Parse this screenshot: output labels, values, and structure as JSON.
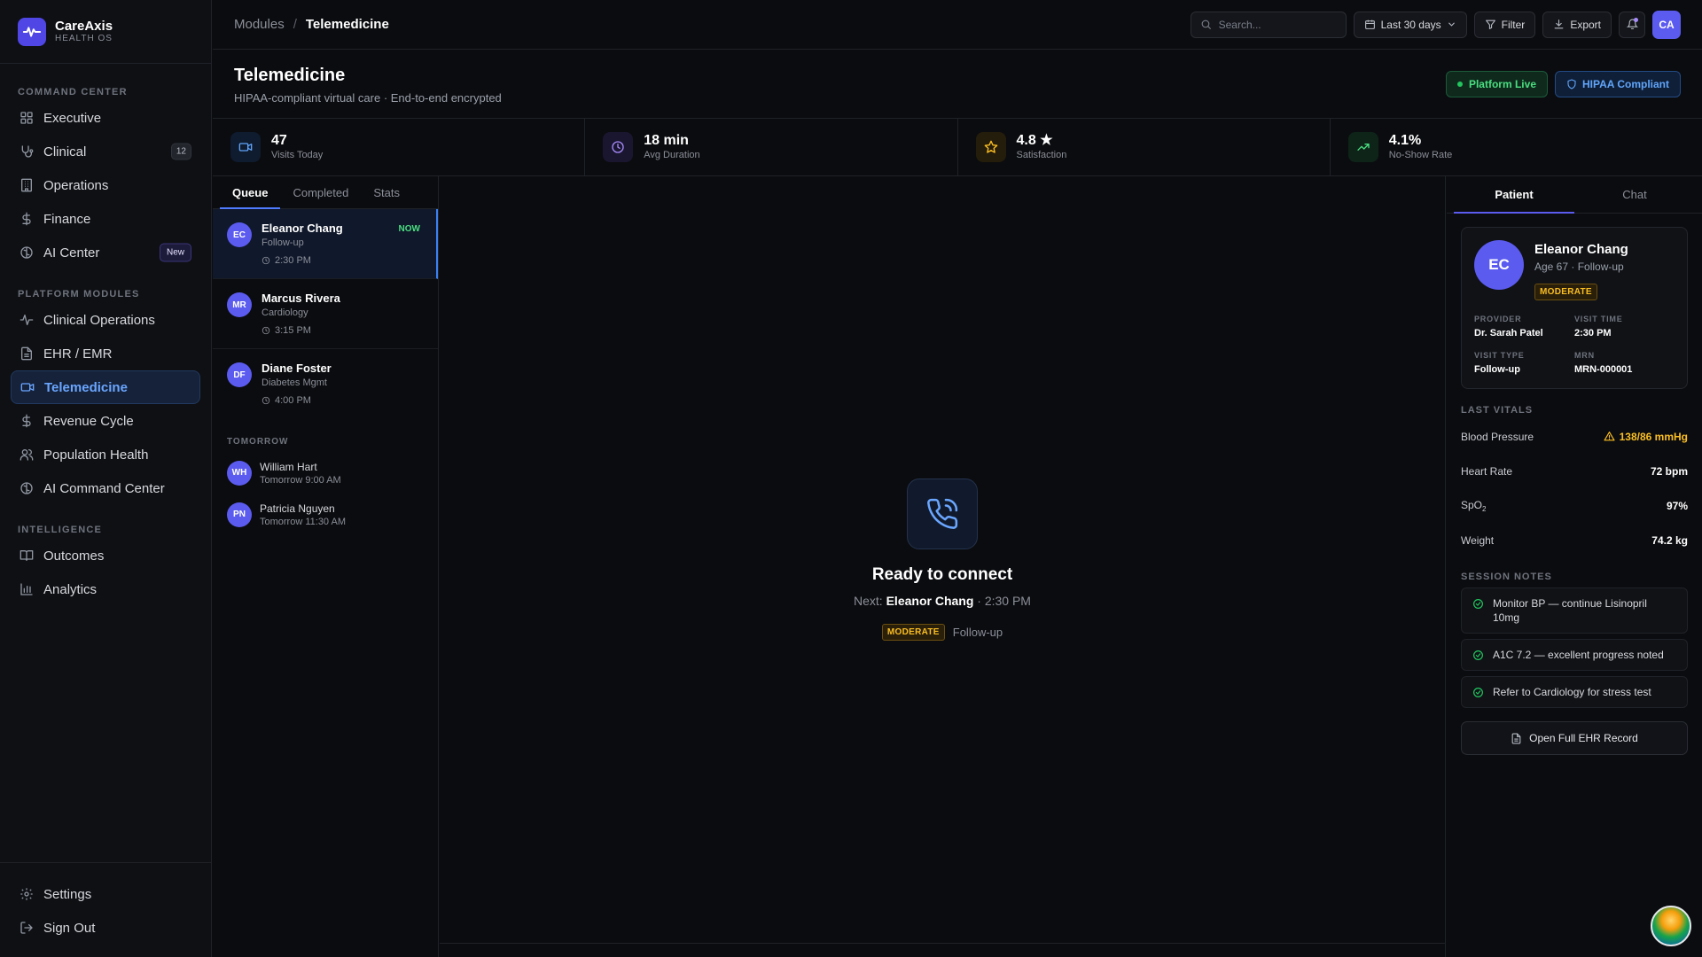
{
  "brand": {
    "name": "CareAxis",
    "sub": "HEALTH OS"
  },
  "sidebar": {
    "sections": [
      {
        "title": "COMMAND CENTER",
        "items": [
          {
            "label": "Executive",
            "icon": "grid-icon"
          },
          {
            "label": "Clinical",
            "icon": "stethoscope-icon",
            "badge": "12"
          },
          {
            "label": "Operations",
            "icon": "building-icon"
          },
          {
            "label": "Finance",
            "icon": "dollar-icon"
          },
          {
            "label": "AI Center",
            "icon": "brain-icon",
            "badge": "New"
          }
        ]
      },
      {
        "title": "PLATFORM MODULES",
        "items": [
          {
            "label": "Clinical Operations",
            "icon": "activity-icon"
          },
          {
            "label": "EHR / EMR",
            "icon": "file-icon"
          },
          {
            "label": "Telemedicine",
            "icon": "video-icon",
            "active": true
          },
          {
            "label": "Revenue Cycle",
            "icon": "dollar-icon"
          },
          {
            "label": "Population Health",
            "icon": "users-icon"
          },
          {
            "label": "AI Command Center",
            "icon": "brain-icon"
          }
        ]
      },
      {
        "title": "INTELLIGENCE",
        "items": [
          {
            "label": "Outcomes",
            "icon": "book-icon"
          },
          {
            "label": "Analytics",
            "icon": "bar-chart-icon"
          }
        ]
      }
    ],
    "footer": [
      {
        "label": "Settings",
        "icon": "gear-icon"
      },
      {
        "label": "Sign Out",
        "icon": "logout-icon"
      }
    ]
  },
  "topbar": {
    "breadcrumb_root": "Modules",
    "breadcrumb_current": "Telemedicine",
    "search_placeholder": "Search...",
    "date_range": "Last 30 days",
    "filter": "Filter",
    "export": "Export",
    "user_initials": "CA"
  },
  "header": {
    "title": "Telemedicine",
    "subtitle": "HIPAA-compliant virtual care · End-to-end encrypted",
    "badge_live": "Platform Live",
    "badge_hipaa": "HIPAA Compliant"
  },
  "stats": [
    {
      "value": "47",
      "label": "Visits Today",
      "icon": "video-icon",
      "color": "#60a5fa",
      "bg": "#0f1b2e"
    },
    {
      "value": "18 min",
      "label": "Avg Duration",
      "icon": "clock-icon",
      "color": "#a78bfa",
      "bg": "#1a1630"
    },
    {
      "value": "4.8 ★",
      "label": "Satisfaction",
      "icon": "star-icon",
      "color": "#fbbf24",
      "bg": "#251d0b"
    },
    {
      "value": "4.1%",
      "label": "No-Show Rate",
      "icon": "trend-up-icon",
      "color": "#4ade80",
      "bg": "#0e2419"
    }
  ],
  "queue": {
    "tabs": [
      "Queue",
      "Completed",
      "Stats"
    ],
    "items": [
      {
        "initials": "EC",
        "name": "Eleanor Chang",
        "type": "Follow-up",
        "time": "2:30 PM",
        "badge": "NOW"
      },
      {
        "initials": "MR",
        "name": "Marcus Rivera",
        "type": "Cardiology",
        "time": "3:15 PM"
      },
      {
        "initials": "DF",
        "name": "Diane Foster",
        "type": "Diabetes Mgmt",
        "time": "4:00 PM"
      }
    ],
    "tomorrow_label": "TOMORROW",
    "tomorrow": [
      {
        "initials": "WH",
        "name": "William Hart",
        "time": "Tomorrow 9:00 AM"
      },
      {
        "initials": "PN",
        "name": "Patricia Nguyen",
        "time": "Tomorrow 11:30 AM"
      }
    ]
  },
  "center": {
    "title": "Ready to connect",
    "next_prefix": "Next:",
    "next_name": "Eleanor Chang",
    "next_time": "· 2:30 PM",
    "risk": "MODERATE",
    "visit_type": "Follow-up"
  },
  "patient": {
    "tabs": [
      "Patient",
      "Chat"
    ],
    "initials": "EC",
    "name": "Eleanor Chang",
    "meta": "Age 67 · Follow-up",
    "risk": "MODERATE",
    "fields": [
      {
        "label": "PROVIDER",
        "value": "Dr. Sarah Patel"
      },
      {
        "label": "VISIT TIME",
        "value": "2:30 PM"
      },
      {
        "label": "VISIT TYPE",
        "value": "Follow-up"
      },
      {
        "label": "MRN",
        "value": "MRN-000001"
      }
    ],
    "vitals_title": "LAST VITALS",
    "vitals": {
      "bp": {
        "label": "Blood Pressure",
        "value": "138/86 mmHg"
      },
      "hr": {
        "label": "Heart Rate",
        "value": "72 bpm"
      },
      "spo2": {
        "label": "SpO",
        "sub": "2",
        "value": "97%"
      },
      "weight": {
        "label": "Weight",
        "value": "74.2 kg"
      }
    },
    "notes_title": "SESSION NOTES",
    "notes": [
      "Monitor BP — continue Lisinopril 10mg",
      "A1C 7.2 — excellent progress noted",
      "Refer to Cardiology for stress test"
    ],
    "ehr_button": "Open Full EHR Record"
  }
}
